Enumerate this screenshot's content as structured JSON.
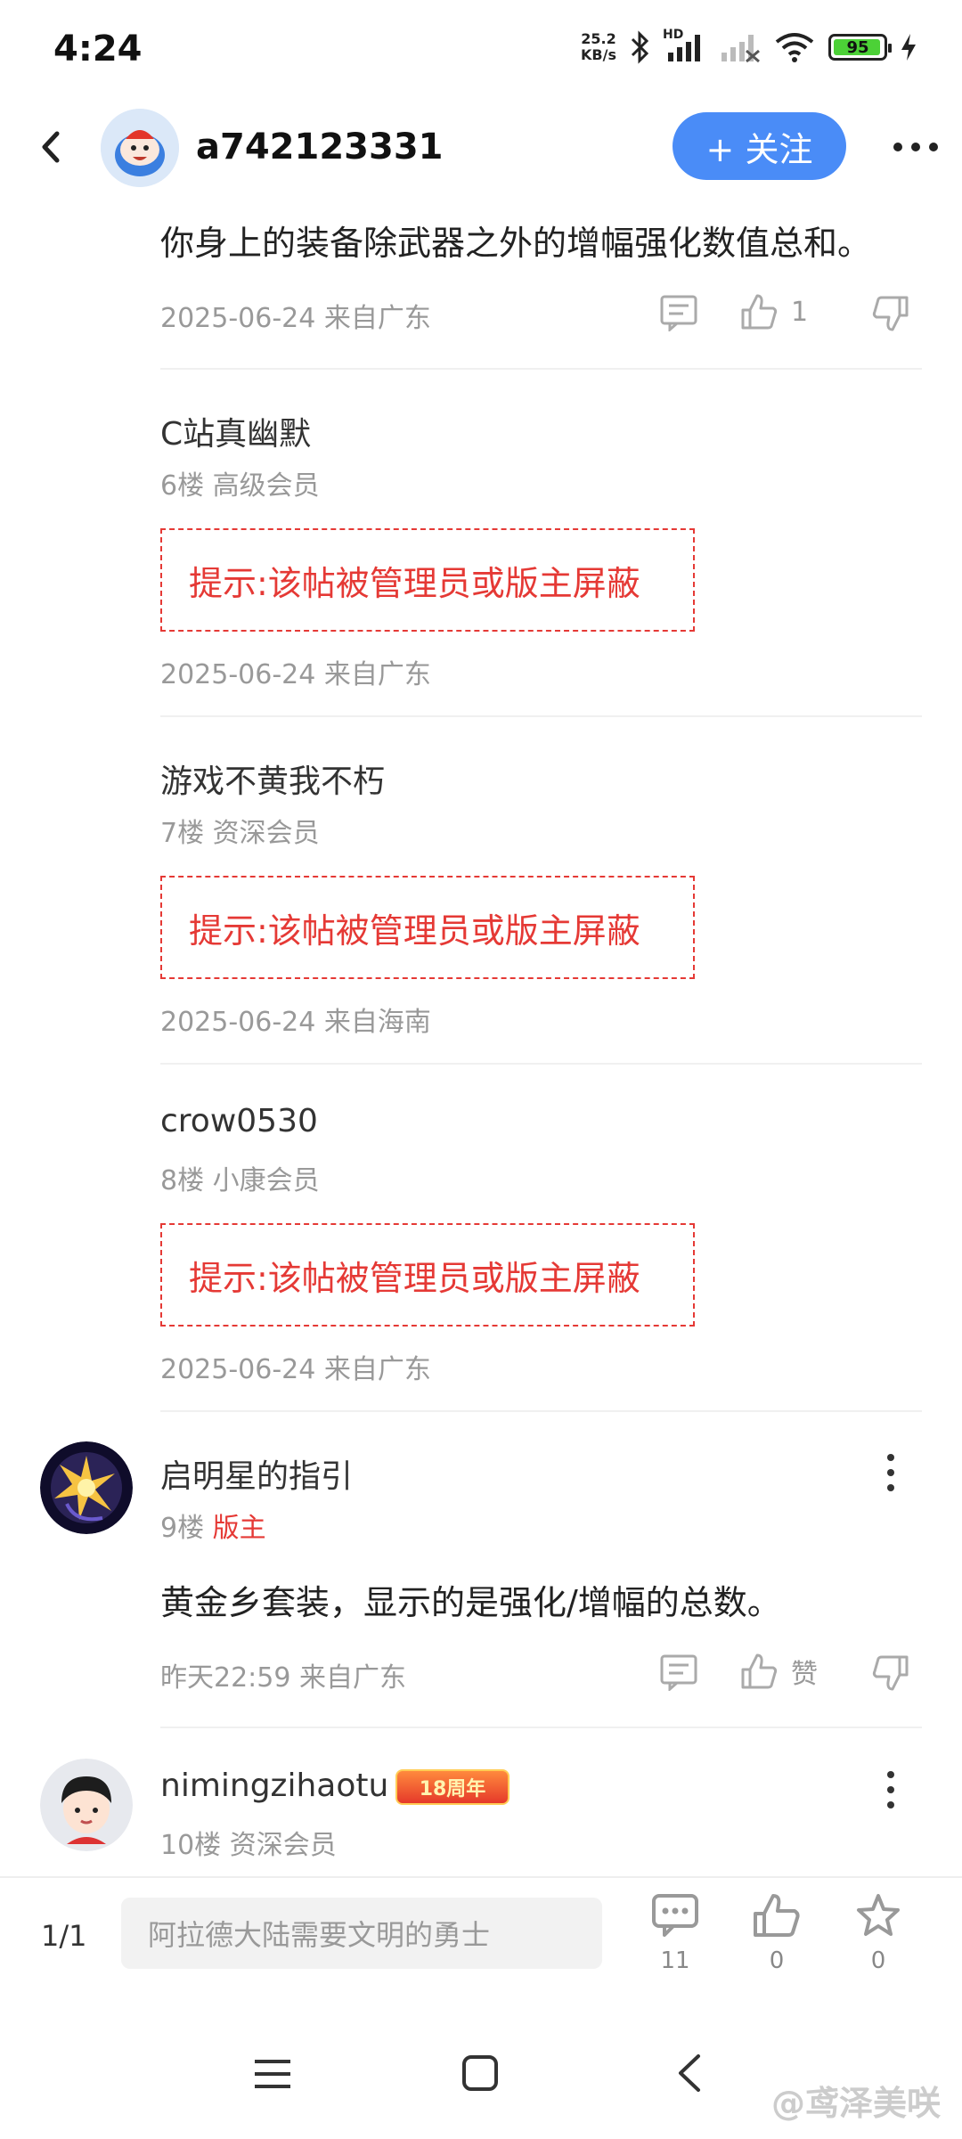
{
  "status_bar": {
    "time": "4:24",
    "net_speed_value": "25.2",
    "net_speed_unit": "KB/s",
    "signal_label": "HD",
    "battery": "95",
    "icons": [
      "bluetooth-icon",
      "signal-icon",
      "signal-no-service-icon",
      "wifi-icon",
      "battery-icon",
      "charging-icon"
    ]
  },
  "header": {
    "username": "a742123331",
    "follow_label": "+ 关注"
  },
  "posts": [
    {
      "text": "你身上的装备除武器之外的增幅强化数值总和。",
      "meta": "2025-06-24 来自广东",
      "like_count": "1"
    },
    {
      "name": "C站真幽默",
      "floor": "6楼 高级会员",
      "blocked": "提示:该帖被管理员或版主屏蔽",
      "meta": "2025-06-24 来自广东"
    },
    {
      "name": "游戏不黄我不朽",
      "floor": "7楼 资深会员",
      "blocked": "提示:该帖被管理员或版主屏蔽",
      "meta": "2025-06-24 来自海南"
    },
    {
      "name": "crow0530",
      "floor": "8楼 小康会员",
      "blocked": "提示:该帖被管理员或版主屏蔽",
      "meta": "2025-06-24 来自广东"
    },
    {
      "name": "启明星的指引",
      "floor_num": "9楼",
      "role": "版主",
      "text": "黄金乡套装，显示的是强化/增幅的总数。",
      "meta": "昨天22:59 来自广东",
      "like_label": "赞"
    },
    {
      "name": "nimingzihaotu",
      "badge": "18周年",
      "floor": "10楼 资深会员"
    }
  ],
  "bottom_bar": {
    "page": "1/1",
    "input_placeholder": "阿拉德大陆需要文明的勇士",
    "comments": "11",
    "likes": "0",
    "favorites": "0"
  },
  "watermark": "@鸢泽美咲"
}
